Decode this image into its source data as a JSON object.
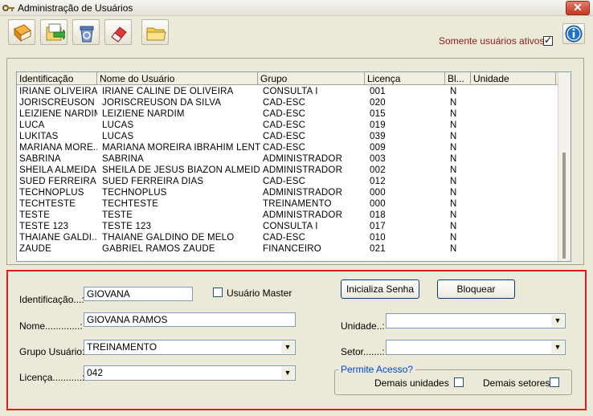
{
  "window": {
    "title": "Administração de Usuários",
    "close_glyph": "✕"
  },
  "toolbar": {
    "icons": [
      "book-icon",
      "export-icon",
      "recycle-bin-icon",
      "eraser-icon",
      "folder-icon"
    ]
  },
  "filter": {
    "label": "Somente usuários ativos?",
    "checked": true,
    "check_glyph": "✓"
  },
  "info": {
    "icon": "info-icon"
  },
  "table": {
    "columns": [
      "Identificação",
      "Nome do Usuário",
      "Grupo",
      "Licença",
      "Bl...",
      "Unidade"
    ],
    "rows": [
      [
        "IRIANE OLIVEIRA",
        "IRIANE CALINE DE OLIVEIRA",
        "CONSULTA I",
        "001",
        "N",
        ""
      ],
      [
        "JORISCREUSON",
        "JORISCREUSON DA SILVA",
        "CAD-ESC",
        "020",
        "N",
        ""
      ],
      [
        "LEIZIENE NARDIM",
        "LEIZIENE NARDIM",
        "CAD-ESC",
        "015",
        "N",
        ""
      ],
      [
        "LUCA",
        "LUCAS",
        "CAD-ESC",
        "019",
        "N",
        ""
      ],
      [
        "LUKITAS",
        "LUCAS",
        "CAD-ESC",
        "039",
        "N",
        ""
      ],
      [
        "MARIANA MORE...",
        "MARIANA MOREIRA IBRAHIM LENTI",
        "CAD-ESC",
        "009",
        "N",
        ""
      ],
      [
        "SABRINA",
        "SABRINA",
        "ADMINISTRADOR",
        "003",
        "N",
        ""
      ],
      [
        "SHEILA ALMEIDA",
        "SHEILA DE JESUS BIAZON ALMEIDA",
        "ADMINISTRADOR",
        "002",
        "N",
        ""
      ],
      [
        "SUED FERREIRA",
        "SUED FERREIRA DIAS",
        "CAD-ESC",
        "012",
        "N",
        ""
      ],
      [
        "TECHNOPLUS",
        "TECHNOPLUS",
        "ADMINISTRADOR",
        "000",
        "N",
        ""
      ],
      [
        "TECHTESTE",
        "TECHTESTE",
        "TREINAMENTO",
        "000",
        "N",
        ""
      ],
      [
        "TESTE",
        "TESTE",
        "ADMINISTRADOR",
        "018",
        "N",
        ""
      ],
      [
        "TESTE 123",
        "TESTE 123",
        "CONSULTA I",
        "017",
        "N",
        ""
      ],
      [
        "THAIANE GALDI...",
        "THAIANE GALDINO DE MELO",
        "CAD-ESC",
        "010",
        "N",
        ""
      ],
      [
        "ZAUDE",
        "GABRIEL RAMOS ZAUDE",
        "FINANCEIRO",
        "021",
        "N",
        ""
      ]
    ]
  },
  "form": {
    "identificacao_label": "Identificação...:",
    "identificacao_value": "GIOVANA",
    "master_label": "Usuário Master",
    "master_checked": false,
    "nome_label": "Nome.............:",
    "nome_value": "GIOVANA RAMOS",
    "grupo_label": "Grupo Usuário:",
    "grupo_value": "TREINAMENTO",
    "licenca_label": "Licença...........:",
    "licenca_value": "042",
    "unidade_label": "Unidade..:",
    "unidade_value": "",
    "setor_label": "Setor.......:",
    "setor_value": "",
    "inicializa_label": "Inicializa Senha",
    "bloquear_label": "Bloquear",
    "permite_title": "Permite Acesso?",
    "demais_unidades_label": "Demais unidades",
    "demais_setores_label": "Demais setores",
    "dropdown_glyph": "▼"
  }
}
